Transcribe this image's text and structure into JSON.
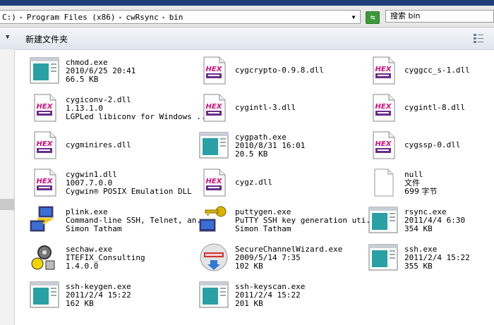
{
  "address": {
    "crumbs": [
      "C:)",
      "Program Files (x86)",
      "cwRsync",
      "bin"
    ],
    "search_placeholder": "搜索 bin"
  },
  "toolbar": {
    "new_folder_label": "新建文件夹"
  },
  "files": [
    {
      "icon": "exe",
      "lines": [
        "chmod.exe",
        "2010/6/25 20:41",
        "66.5 KB"
      ]
    },
    {
      "icon": "dll",
      "lines": [
        "cygcrypto-0.9.8.dll"
      ]
    },
    {
      "icon": "dll",
      "lines": [
        "cyggcc_s-1.dll"
      ]
    },
    {
      "icon": "dll",
      "lines": [
        "cygiconv-2.dll",
        "1.13.1.0",
        "LGPLed libiconv for Windows ..."
      ]
    },
    {
      "icon": "dll",
      "lines": [
        "cygintl-3.dll"
      ]
    },
    {
      "icon": "dll",
      "lines": [
        "cygintl-8.dll"
      ]
    },
    {
      "icon": "dll",
      "lines": [
        "cygminires.dll"
      ]
    },
    {
      "icon": "exe",
      "lines": [
        "cygpath.exe",
        "2010/8/31 16:01",
        "20.5 KB"
      ]
    },
    {
      "icon": "dll",
      "lines": [
        "cygssp-0.dll"
      ]
    },
    {
      "icon": "dll",
      "lines": [
        "cygwin1.dll",
        "1007.7.0.0",
        "Cygwin® POSIX Emulation DLL"
      ]
    },
    {
      "icon": "dll",
      "lines": [
        "cygz.dll"
      ]
    },
    {
      "icon": "file",
      "lines": [
        "null",
        "文件",
        "699 字节"
      ]
    },
    {
      "icon": "plink",
      "lines": [
        "plink.exe",
        "Command-line SSH, Telnet, an...",
        "Simon Tatham"
      ]
    },
    {
      "icon": "puttygen",
      "lines": [
        "puttygen.exe",
        "PuTTY SSH key generation uti...",
        "Simon Tatham"
      ]
    },
    {
      "icon": "exe",
      "lines": [
        "rsync.exe",
        "2011/4/4 6:30",
        "354 KB"
      ]
    },
    {
      "icon": "gear",
      "lines": [
        "sechaw.exe",
        "ITEFIX_Consulting",
        "1.4.0.0"
      ]
    },
    {
      "icon": "wizard",
      "lines": [
        "SecureChannelWizard.exe",
        "2009/5/14 7:35",
        "102 KB"
      ]
    },
    {
      "icon": "exe",
      "lines": [
        "ssh.exe",
        "2011/2/4 15:22",
        "355 KB"
      ]
    },
    {
      "icon": "exe",
      "lines": [
        "ssh-keygen.exe",
        "2011/2/4 15:22",
        "162 KB"
      ]
    },
    {
      "icon": "exe",
      "lines": [
        "ssh-keyscan.exe",
        "2011/2/4 15:22",
        "201 KB"
      ]
    }
  ]
}
